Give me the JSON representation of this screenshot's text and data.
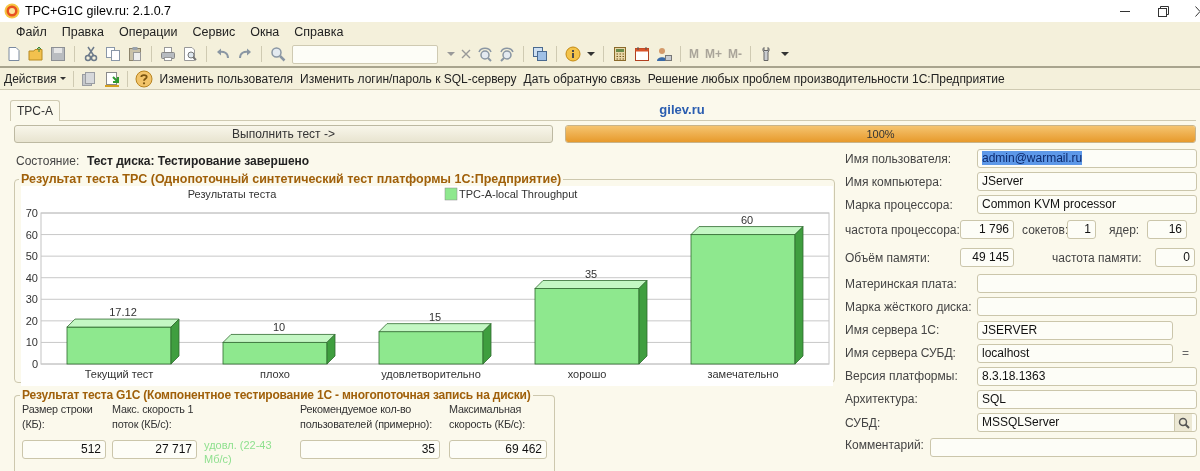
{
  "window": {
    "title": "TPC+G1C gilev.ru: 2.1.0.7"
  },
  "menu": [
    "Файл",
    "Правка",
    "Операции",
    "Сервис",
    "Окна",
    "Справка"
  ],
  "toolbar": {
    "memory_buttons": [
      {
        "label": "M",
        "disabled": true
      },
      {
        "label": "M+",
        "disabled": true
      },
      {
        "label": "M-",
        "disabled": true
      }
    ]
  },
  "actions": {
    "menu_label": "Действия",
    "links": [
      "Изменить пользователя",
      "Изменить логин/пароль к SQL-серверу",
      "Дать обратную связь",
      "Решение любых проблем производительности 1С:Предприятие"
    ]
  },
  "tabs": [
    {
      "label": "TPC-A",
      "selected": true
    }
  ],
  "site_label": "gilev.ru",
  "run_button": "Выполнить тест ->",
  "progress": {
    "level": 1,
    "reading": "100%"
  },
  "status": {
    "label": "Состояние:",
    "value": "Тест диска: Тестирование завершено"
  },
  "tpc_group": {
    "title": "Результат теста TPC (Однопоточный синтетический тест платформы 1С:Предприятие)",
    "chart_data": {
      "type": "bar",
      "title": "Результаты теста",
      "categories": [
        "Текущий тест",
        "плохо",
        "удовлетворительно",
        "хорошо",
        "замечательно"
      ],
      "series": [
        {
          "name": "TPC-A-local Throughput",
          "color": "#8ee88e",
          "values": [
            17.12,
            10,
            15,
            35,
            60
          ]
        }
      ],
      "ylim": [
        0,
        70
      ],
      "grid": true,
      "yticks": [
        0,
        10,
        20,
        30,
        40,
        50,
        60,
        70
      ],
      "value_labels": [
        "17.12",
        "10",
        "15",
        "35",
        "60"
      ]
    }
  },
  "g1c_group": {
    "title": "Результат теста G1C (Компонентное тестирование 1С - многопоточная запись на диски)",
    "columns": [
      {
        "label": "Размер строки (КБ):",
        "value": "512"
      },
      {
        "label": "Макс. скорость 1 поток (КБ/с):",
        "value": "27 717",
        "note": "удовл. (22-43 Мб/с)"
      },
      {
        "label": "Рекомендуемое кол-во пользователей (примерно):",
        "value": "35"
      },
      {
        "label": "Максимальная скорость (КБ/с):",
        "value": "69 462"
      }
    ]
  },
  "info_form": [
    {
      "kind": "field",
      "label": "Имя пользователя:",
      "value": "admin@warmail.ru",
      "text_selected": true
    },
    {
      "kind": "field",
      "label": "Имя компьютера:",
      "value": "JServer",
      "text_selected": false
    },
    {
      "kind": "field",
      "label": "Марка процессора:",
      "value": "Common KVM processor",
      "text_selected": false
    },
    {
      "kind": "cpu",
      "label": "частота процессора:",
      "value": "1 796",
      "text_selected": false,
      "parts": [
        {
          "label": "сокетов:",
          "value": "1"
        },
        {
          "label": "ядер:",
          "value": "16"
        }
      ]
    },
    {
      "kind": "memory",
      "label": "Объём памяти:",
      "value": "49 145",
      "text_selected": false,
      "parts": [
        {
          "label": "частота памяти:",
          "value": "0"
        }
      ]
    },
    {
      "kind": "field",
      "label": "Материнская плата:"
    },
    {
      "kind": "field",
      "label": "Марка жёсткого диска:"
    },
    {
      "kind": "short",
      "label": "Имя сервера 1С:",
      "value": "JSERVER",
      "text_selected": false
    },
    {
      "kind": "short",
      "label": "Имя сервера СУБД:",
      "value": "localhost",
      "text_selected": false,
      "suffix": "="
    },
    {
      "kind": "field",
      "label": "Версия платформы:",
      "value": "8.3.18.1363",
      "text_selected": false
    },
    {
      "kind": "field",
      "label": "Архитектура:",
      "value": "SQL",
      "text_selected": false
    },
    {
      "kind": "lookup",
      "label": "СУБД:",
      "value": "MSSQLServer",
      "text_selected": false
    },
    {
      "kind": "memo",
      "label": "Комментарий:"
    }
  ]
}
